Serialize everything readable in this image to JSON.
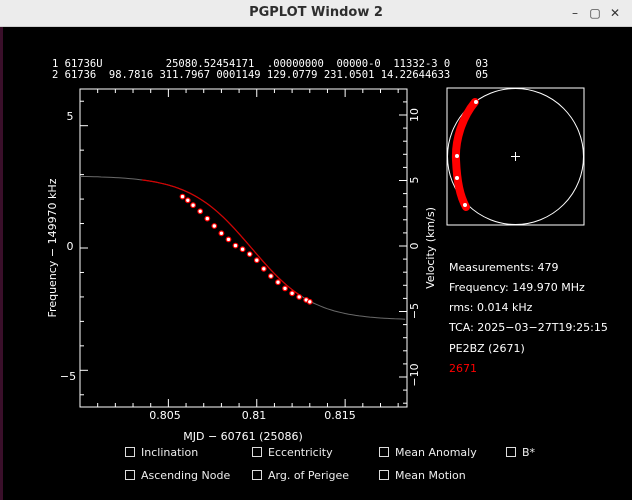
{
  "window": {
    "title": "PGPLOT Window 2",
    "controls": [
      "–",
      "▢",
      "✕"
    ]
  },
  "tle": {
    "line1": "1 61736U          25080.52454171  .00000000  00000-0  11332-3 0    03",
    "line2": "2 61736  98.7816 311.7967 0001149 129.0779 231.0501 14.22644633    05"
  },
  "main_plot": {
    "ylabel": "Frequency − 149970 kHz",
    "ylabel_right": "Velocity (km/s)",
    "xlabel": "MJD − 60761 (25086)",
    "xticks": [
      "0.805",
      "0.81",
      "0.815"
    ],
    "yticks_left": [
      "5",
      "0",
      "−5"
    ],
    "yticks_right": [
      "10",
      "5",
      "0",
      "−5",
      "−10"
    ],
    "curve_color": "#d40000",
    "point_color": "#ff0000"
  },
  "chart_data": {
    "type": "scatter",
    "xlabel": "MJD − 60761 (25086)",
    "ylabel": "Frequency − 149970 kHz",
    "xlim": [
      0.8,
      0.8185
    ],
    "ylim": [
      -6.5,
      6.5
    ],
    "series": [
      {
        "x": [
          0.8058,
          0.8061,
          0.8064,
          0.8068,
          0.8072,
          0.8076,
          0.808,
          0.8084,
          0.8088,
          0.8092,
          0.8096,
          0.81,
          0.8104,
          0.8108,
          0.8112,
          0.8116,
          0.812,
          0.8124,
          0.8128,
          0.813
        ],
        "y": [
          2.1,
          1.95,
          1.75,
          1.5,
          1.2,
          0.9,
          0.6,
          0.35,
          0.1,
          -0.05,
          -0.25,
          -0.5,
          -0.85,
          -1.15,
          -1.4,
          -1.65,
          -1.85,
          -2.0,
          -2.12,
          -2.2
        ]
      }
    ]
  },
  "side_info": {
    "measurements": "Measurements: 479",
    "frequency": "Frequency: 149.970 MHz",
    "rms": "rms: 0.014 kHz",
    "tca": "TCA: 2025−03−27T19:25:15",
    "station": "PE2BZ (2671)",
    "station_id": "2671",
    "station_id_color": "#ff0000"
  },
  "checkboxes": [
    {
      "label": "Inclination"
    },
    {
      "label": "Eccentricity"
    },
    {
      "label": "Mean Anomaly"
    },
    {
      "label": "B*"
    },
    {
      "label": "Ascending Node"
    },
    {
      "label": "Arg. of Perigee"
    },
    {
      "label": "Mean Motion"
    }
  ]
}
